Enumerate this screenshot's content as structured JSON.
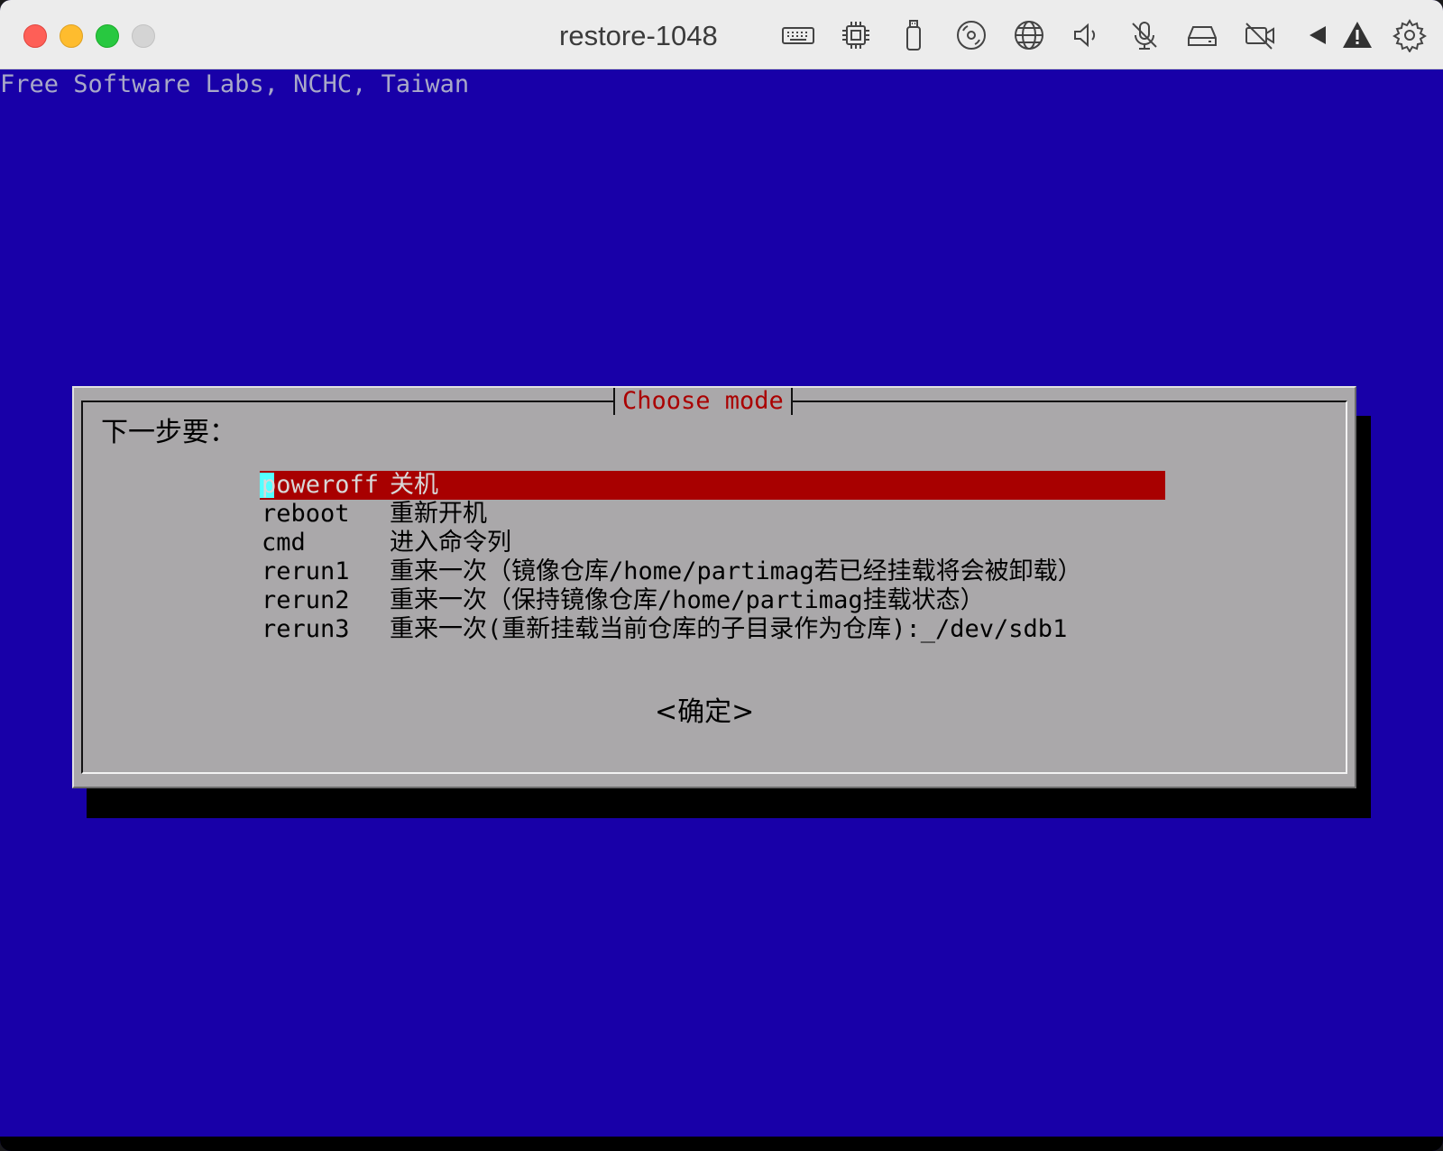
{
  "window": {
    "title": "restore-1048"
  },
  "toolbar_icons": [
    "keyboard-icon",
    "cpu-icon",
    "usb-drive-icon",
    "disc-icon",
    "network-icon",
    "speaker-icon",
    "microphone-muted-icon",
    "hard-drive-icon",
    "camera-off-icon",
    "back-arrow-icon",
    "warning-icon",
    "gear-icon"
  ],
  "screen": {
    "header": "Free Software Labs, NCHC, Taiwan",
    "background_color": "#1800a8"
  },
  "dialog": {
    "title": "Choose mode",
    "prompt": "下一步要：",
    "items": [
      {
        "tag": "poweroff",
        "description": "关机",
        "selected": true
      },
      {
        "tag": "reboot",
        "description": "重新开机",
        "selected": false
      },
      {
        "tag": "cmd",
        "description": "进入命令列",
        "selected": false
      },
      {
        "tag": "rerun1",
        "description": "重来一次（镜像仓库/home/partimag若已经挂载将会被卸载）",
        "selected": false
      },
      {
        "tag": "rerun2",
        "description": "重来一次（保持镜像仓库/home/partimag挂载状态）",
        "selected": false
      },
      {
        "tag": "rerun3",
        "description": "重来一次(重新挂载当前仓库的子目录作为仓库):_/dev/sdb1",
        "selected": false
      }
    ],
    "ok_label": "<确定>"
  },
  "colors": {
    "selection": "#a80000",
    "title_text": "#aa0000",
    "cursor": "#55ffff"
  }
}
